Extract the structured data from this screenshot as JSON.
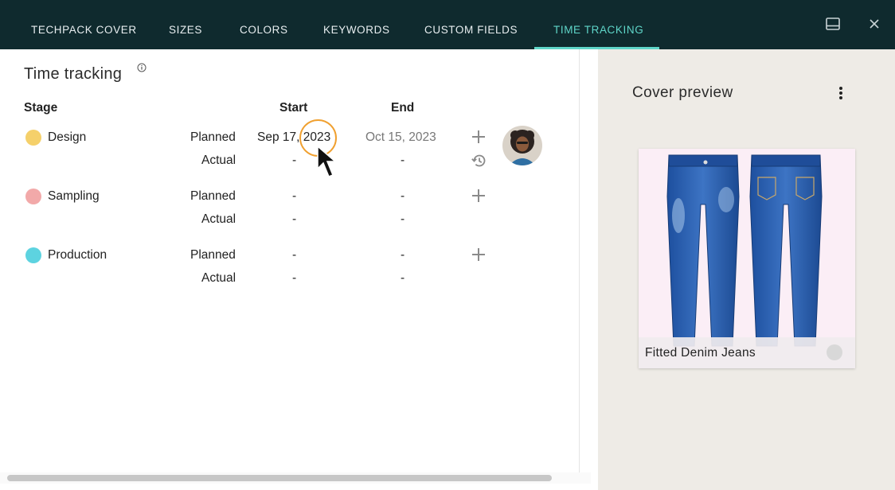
{
  "tabs": [
    {
      "label": "TECHPACK COVER"
    },
    {
      "label": "SIZES"
    },
    {
      "label": "COLORS"
    },
    {
      "label": "KEYWORDS"
    },
    {
      "label": "CUSTOM FIELDS"
    },
    {
      "label": "TIME TRACKING",
      "active": true
    }
  ],
  "toolbar_icons": [
    "panel-toggle-icon",
    "close-icon"
  ],
  "time_tracking": {
    "title": "Time tracking",
    "info_icon": "info-icon",
    "headers": {
      "stage": "Stage",
      "start": "Start",
      "end": "End"
    },
    "stages": [
      {
        "name": "Design",
        "color": "#f5d06a",
        "planned_label": "Planned",
        "planned_start": "Sep 17, 2023",
        "planned_end": "Oct 15, 2023",
        "actual_label": "Actual",
        "actual_start": "-",
        "actual_end": "-"
      },
      {
        "name": "Sampling",
        "color": "#f2a9a9",
        "planned_label": "Planned",
        "planned_start": "-",
        "planned_end": "-",
        "actual_label": "Actual",
        "actual_start": "-",
        "actual_end": "-"
      },
      {
        "name": "Production",
        "color": "#5dd3e0",
        "planned_label": "Planned",
        "planned_start": "-",
        "planned_end": "-",
        "actual_label": "Actual",
        "actual_start": "-",
        "actual_end": "-"
      }
    ]
  },
  "cover_preview": {
    "title": "Cover preview",
    "menu_icon": "more-vertical-icon",
    "card_label": "Fitted Denim Jeans"
  },
  "colors": {
    "topbar": "#0f2a2e",
    "accent": "#5fd6c9",
    "highlight": "#f0a030",
    "right_panel": "#eeebe6"
  }
}
